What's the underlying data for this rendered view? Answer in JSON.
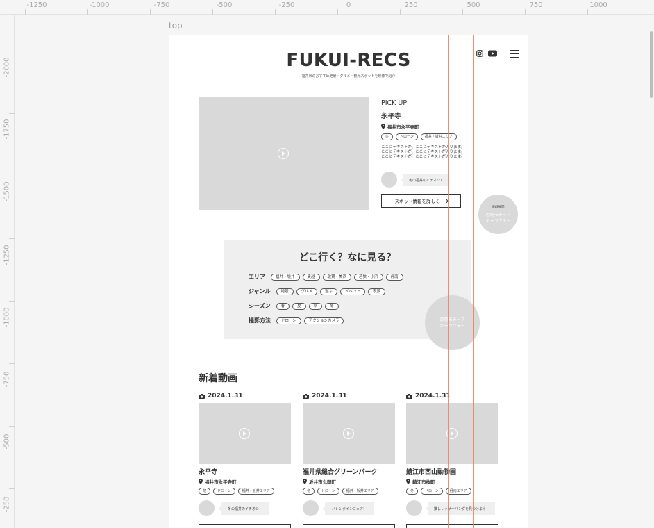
{
  "canvas": {
    "frame_name": "top",
    "ruler_x": [
      "-1250",
      "-1000",
      "-750",
      "-500",
      "-250",
      "0",
      "250",
      "500",
      "750",
      "1000"
    ],
    "ruler_y": [
      "-2000",
      "-1750",
      "-1500",
      "-1250",
      "-1000",
      "-750",
      "-500",
      "-250"
    ]
  },
  "header": {
    "logo": "FUKUI-RECS",
    "tagline": "福井県のおすすめ絶景・グルメ・観光スポットを映像で紹介",
    "icons": [
      "instagram-icon",
      "youtube-icon",
      "menu-icon"
    ]
  },
  "pickup": {
    "label": "PICK UP",
    "title": "永平寺",
    "location": "福井市永平寺町",
    "tags": [
      "冬",
      "ドローン",
      "福井・坂井エリア"
    ],
    "description": "ここにテキストが、ここにテキストが入ります。ここにテキストが、ここにテキストが入ります。ここにテキストが、ここにテキストが入ります。",
    "comment": "冬の福井のイチオシ！",
    "button": "スポット情報を詳しく"
  },
  "character_float": {
    "sns_label": "SNS展開",
    "line1": "恐竜モチーフ",
    "line2": "キャラクター"
  },
  "search": {
    "title": "どこ行く？なに見る？",
    "rows": [
      {
        "label": "エリア",
        "tags": [
          "福井・坂井",
          "奥越",
          "敦賀・美浜",
          "若狭・小浜",
          "丹南"
        ]
      },
      {
        "label": "ジャンル",
        "tags": [
          "絶景",
          "グルメ",
          "遊ぶ",
          "イベント",
          "夜景"
        ]
      },
      {
        "label": "シーズン",
        "tags": [
          "春",
          "夏",
          "秋",
          "冬"
        ]
      },
      {
        "label": "撮影方法",
        "tags": [
          "ドローン",
          "アクションカメラ"
        ]
      }
    ],
    "character": {
      "line1": "恐竜モチーフ",
      "line2": "キャラクター"
    }
  },
  "news": {
    "title": "新着動画",
    "cards": [
      {
        "date": "2024.1.31",
        "title": "永平寺",
        "location": "福井市永平寺町",
        "tags": [
          "冬",
          "ドローン",
          "福井・坂井エリア"
        ],
        "comment": "冬の福井のイチオシ！"
      },
      {
        "date": "2024.1.31",
        "title": "福井県総合グリーンパーク",
        "location": "坂井市丸岡町",
        "tags": [
          "冬",
          "ドローン",
          "福井・坂井エリア"
        ],
        "comment": "バレンタインフェア！"
      },
      {
        "date": "2024.1.31",
        "title": "鯖江市西山動物園",
        "location": "鯖江市桜町",
        "tags": [
          "冬",
          "ドローン",
          "丹南エリア"
        ],
        "comment": "推しレッサーパンダを見つけよう！"
      }
    ]
  },
  "colors": {
    "guide": "#f07a5a",
    "placeholder": "#d9d9d9",
    "panel": "#efefef"
  }
}
